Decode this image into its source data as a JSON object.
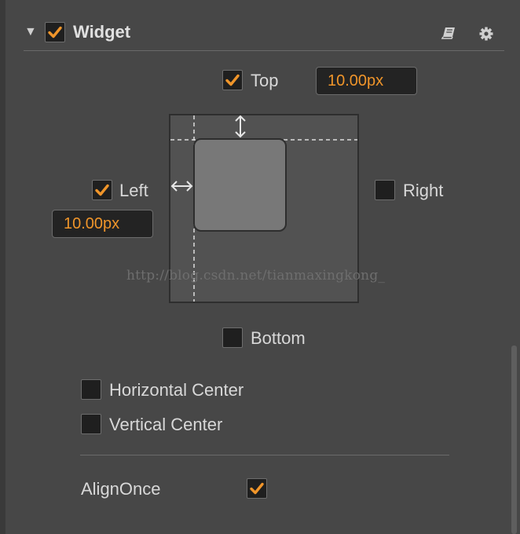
{
  "header": {
    "collapse_glyph": "▼",
    "title": "Widget",
    "enabled": true,
    "icons": [
      "book-icon",
      "gear-icon"
    ]
  },
  "align": {
    "top": {
      "label": "Top",
      "checked": true,
      "value": "10.00px"
    },
    "left": {
      "label": "Left",
      "checked": true,
      "value": "10.00px"
    },
    "right": {
      "label": "Right",
      "checked": false
    },
    "bottom": {
      "label": "Bottom",
      "checked": false
    },
    "horizontal_center": {
      "label": "Horizontal Center",
      "checked": false
    },
    "vertical_center": {
      "label": "Vertical Center",
      "checked": false
    }
  },
  "align_once": {
    "label": "AlignOnce",
    "checked": true
  },
  "watermark": "http://blog.csdn.net/tianmaxingkong_",
  "colors": {
    "accent": "#f0952a",
    "panel_bg": "#474747",
    "checkbox_bg": "#1f1f1f",
    "input_bg": "#232323"
  }
}
